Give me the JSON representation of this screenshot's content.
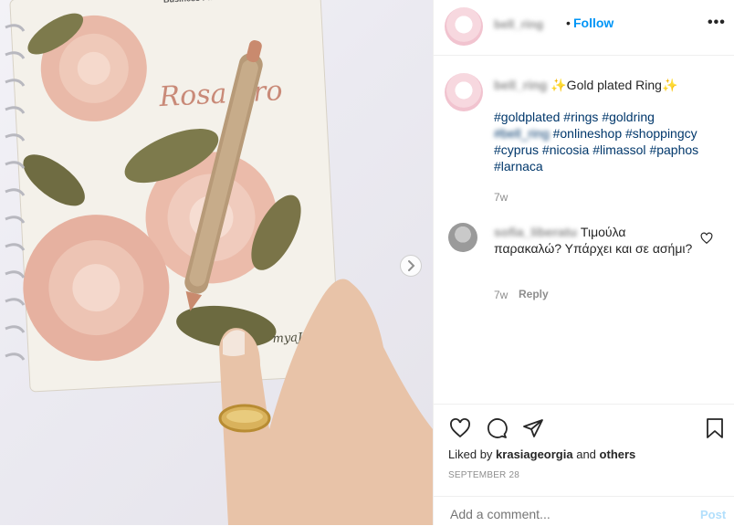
{
  "post": {
    "username": "bell_ring",
    "follow_label": "Follow",
    "caption_user": "bell_ring",
    "caption_title": "✨Gold plated Ring✨",
    "hashtags_line1": [
      "#goldplated",
      "#rings",
      "#goldring"
    ],
    "hashtags_blurred": "#bell_ring",
    "hashtags_line2": [
      "#onlineshop",
      "#shoppingcy"
    ],
    "hashtags_line3": [
      "#cyprus",
      "#nicosia",
      "#limassol",
      "#paphos"
    ],
    "hashtags_line4": [
      "#larnaca"
    ],
    "caption_time": "7w"
  },
  "comment": {
    "username": "sofia_liberatu",
    "text": "Τιμούλα παρακαλώ? Υπάρχει και σε ασήμι?",
    "time": "7w",
    "reply_label": "Reply"
  },
  "actions": {
    "liked_by_prefix": "Liked by",
    "liked_by_user": "krasiageorgia",
    "liked_by_and": "and",
    "liked_by_others": "others",
    "date": "SEPTEMBER 28"
  },
  "add_comment": {
    "placeholder": "Add a comment...",
    "post_label": "Post"
  },
  "media": {
    "cover_title": "Rosa",
    "cover_title2": "Oro",
    "cover_brand": "myaJenda",
    "cover_top": "Business Planner"
  },
  "colors": {
    "accent": "#0095f6",
    "link": "#00376b",
    "muted": "#8e8e8e"
  }
}
